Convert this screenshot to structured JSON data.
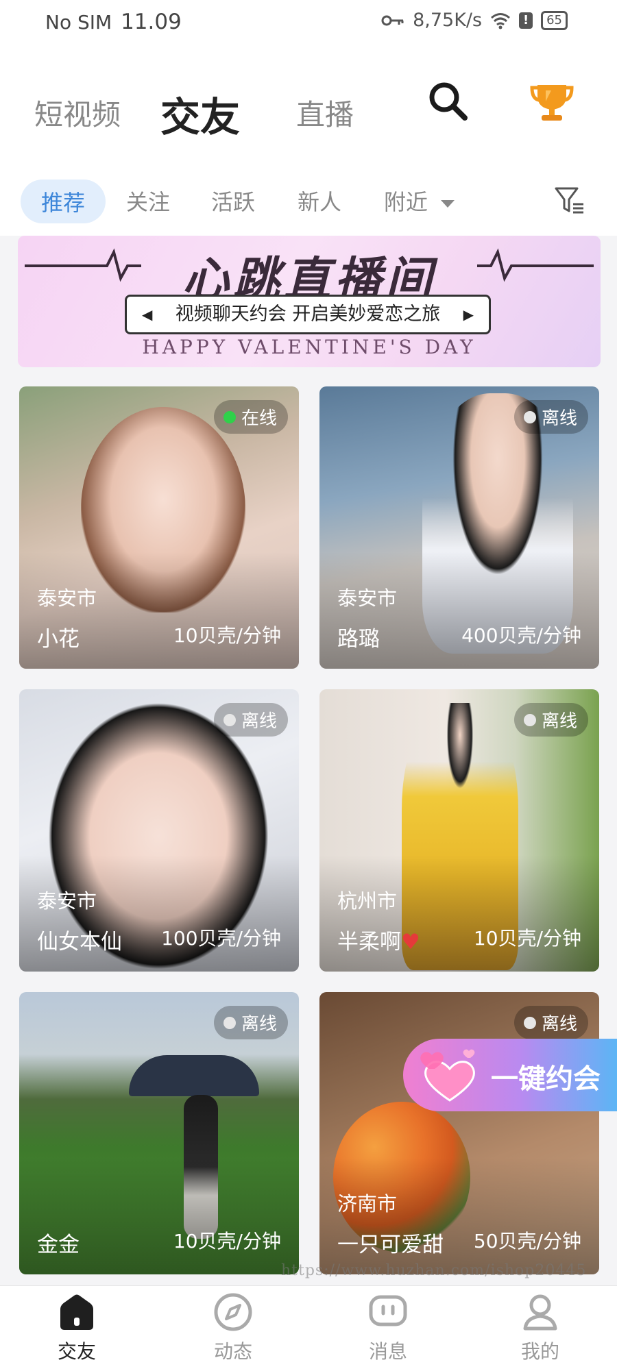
{
  "status_bar": {
    "carrier": "No SIM",
    "time": "11.09",
    "speed": "8,75K/s",
    "battery": "65"
  },
  "header": {
    "tabs": [
      {
        "label": "短视频"
      },
      {
        "label": "交友"
      },
      {
        "label": "直播"
      }
    ],
    "active_tab": "交友"
  },
  "subtabs": {
    "items": [
      {
        "label": "推荐"
      },
      {
        "label": "关注"
      },
      {
        "label": "活跃"
      },
      {
        "label": "新人"
      },
      {
        "label": "附近"
      }
    ],
    "active": "推荐"
  },
  "banner": {
    "title": "心跳直播间",
    "pill_text": "视频聊天约会 开启美妙爱恋之旅",
    "subtitle": "HAPPY VALENTINE'S DAY"
  },
  "cards": [
    {
      "status": "在线",
      "city": "泰安市",
      "name": "小花",
      "price": "10贝壳/分钟"
    },
    {
      "status": "离线",
      "city": "泰安市",
      "name": "路璐",
      "price": "400贝壳/分钟"
    },
    {
      "status": "离线",
      "city": "泰安市",
      "name": "仙女本仙",
      "price": "100贝壳/分钟"
    },
    {
      "status": "离线",
      "city": "杭州市",
      "name": "半柔啊",
      "price": "10贝壳/分钟"
    },
    {
      "status": "离线",
      "city": "",
      "name": "金金",
      "price": "10贝壳/分钟"
    },
    {
      "status": "离线",
      "city": "济南市",
      "name": "一只可爱甜",
      "price": "50贝壳/分钟"
    }
  ],
  "quick_date": {
    "label": "一键约会"
  },
  "watermark": "https://www.huzhan.com/ishop20445",
  "navbar": {
    "items": [
      {
        "label": "交友"
      },
      {
        "label": "动态"
      },
      {
        "label": "消息"
      },
      {
        "label": "我的"
      }
    ],
    "active": "交友"
  },
  "colors": {
    "accent": "#3d86d9",
    "online": "#2fd14a",
    "trophy": "#f39a1d"
  }
}
